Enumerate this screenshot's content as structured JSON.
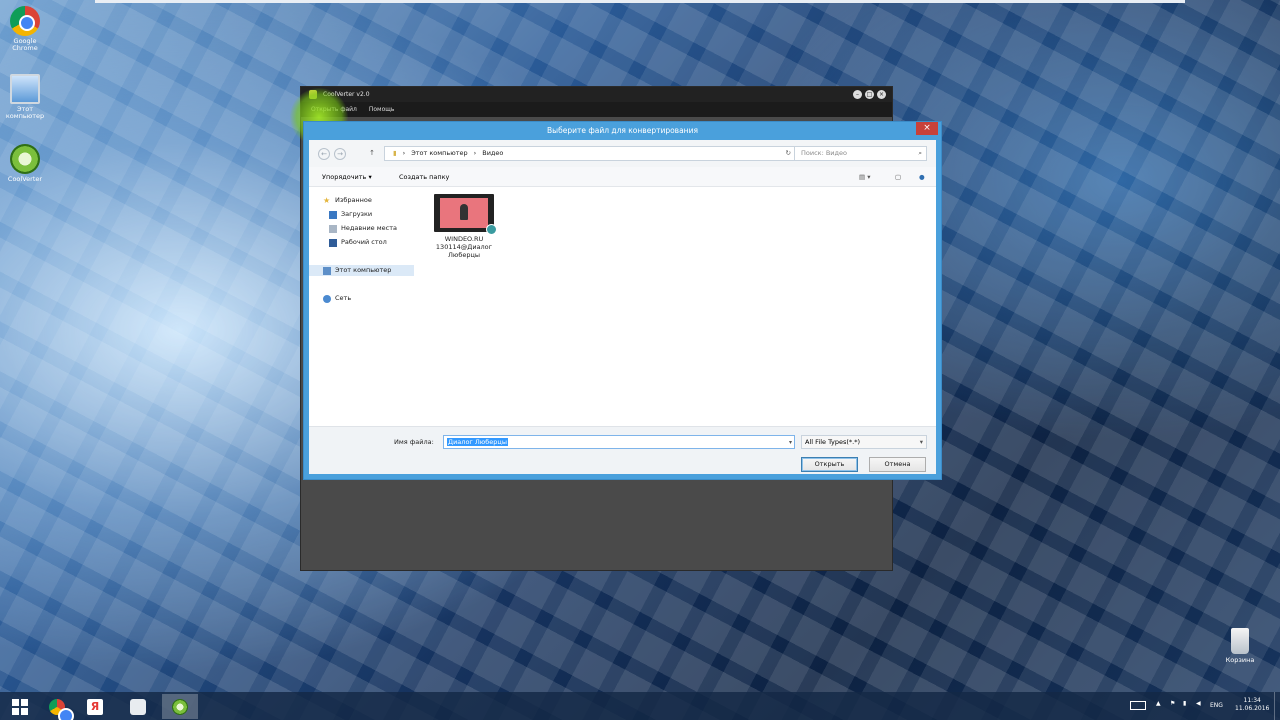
{
  "desktop": {
    "icons": [
      {
        "label_1": "Google",
        "label_2": "Chrome"
      },
      {
        "label_1": "Этот",
        "label_2": "компьютер"
      },
      {
        "label_1": "CoolVerter",
        "label_2": ""
      }
    ],
    "recycle_bin": "Корзина"
  },
  "converter": {
    "title": "CoolVerter v2.0",
    "menu": [
      "Открыть файл",
      "Помощь"
    ],
    "controls": [
      "–",
      "□",
      "×"
    ]
  },
  "dialog": {
    "title": "Выберите файл для конвертирования",
    "close": "×",
    "back": "←",
    "forward": "→",
    "up": "↑",
    "path": [
      "Этот компьютер",
      "Видео"
    ],
    "path_sep": "›",
    "refresh": "↻",
    "search_placeholder": "Поиск: Видео",
    "organize": "Упорядочить ▾",
    "new_folder": "Создать папку",
    "nav": {
      "favorites": "Избранное",
      "downloads": "Загрузки",
      "recent": "Недавние места",
      "desktop": "Рабочий стол",
      "this_pc": "Этот компьютер",
      "network": "Сеть"
    },
    "file": {
      "line1": "WINDEO.RU",
      "line2": "130114@Диалог",
      "line3": "Люберцы"
    },
    "filename_label": "Имя файла:",
    "filename_value": "Диалог Люберцы",
    "filetype": "All File Types(*.*)",
    "open_button": "Открыть",
    "cancel_button": "Отмена"
  },
  "tray": {
    "lang": "ENG",
    "time": "11:34",
    "date": "11.06.2016"
  }
}
